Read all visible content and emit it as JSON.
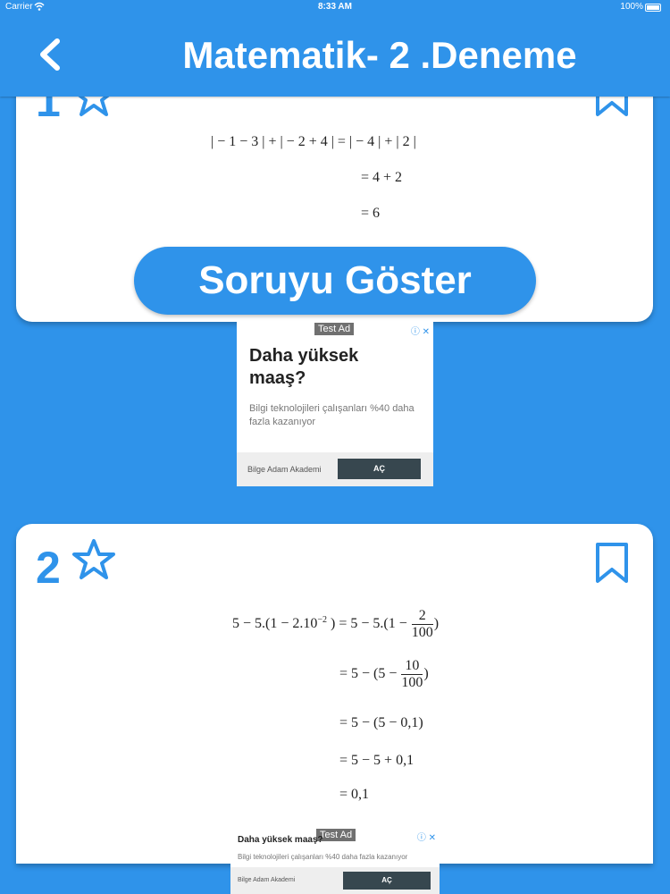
{
  "status": {
    "carrier": "Carrier",
    "time": "8:33 AM",
    "battery": "100%"
  },
  "nav": {
    "title": "Matematik- 2 .Deneme"
  },
  "cards": [
    {
      "number": "1",
      "lines": [
        "| − 1 − 3 | + | − 2 + 4 | = | − 4 | + | 2 |",
        "= 4 + 2",
        "= 6"
      ],
      "button": "Soruyu Göster"
    },
    {
      "number": "2",
      "line1_left": "5 − 5.(1 − 2.10",
      "line1_exp": "−2",
      "line1_mid": ") = 5 − 5.(1 −",
      "line1_num": "2",
      "line1_den": "100",
      "line1_end": ")",
      "line2_pre": "= 5 − (5 −",
      "line2_num": "10",
      "line2_den": "100",
      "line2_end": ")",
      "line3": "= 5 − (5 − 0,1)",
      "line4": "= 5 − 5 + 0,1",
      "line5": "= 0,1"
    }
  ],
  "ads": [
    {
      "tag": "Test Ad",
      "headline": "Daha yüksek maaş?",
      "body": "Bilgi teknolojileri çalışanları %40 daha fazla kazanıyor",
      "advertiser": "Bilge Adam Akademi",
      "cta": "AÇ"
    },
    {
      "tag": "Test Ad",
      "headline": "Daha yüksek maaş?",
      "body": "Bilgi teknolojileri çalışanları %40 daha fazla kazanıyor",
      "advertiser": "Bilge Adam Akademi",
      "cta": "AÇ"
    }
  ],
  "colors": {
    "primary": "#2f93ea",
    "card": "#ffffff",
    "cta": "#37474f"
  }
}
